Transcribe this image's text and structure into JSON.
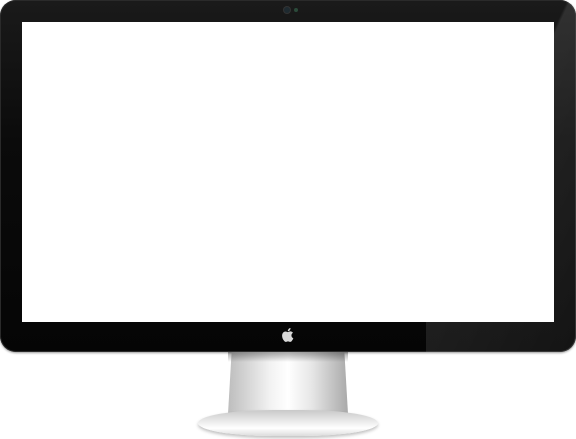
{
  "device": {
    "type": "desktop-monitor",
    "brand_icon": "apple-logo-icon",
    "bezel_color": "#0b0b0b",
    "screen_color": "#ffffff",
    "stand_color": "#e6e6e6"
  }
}
